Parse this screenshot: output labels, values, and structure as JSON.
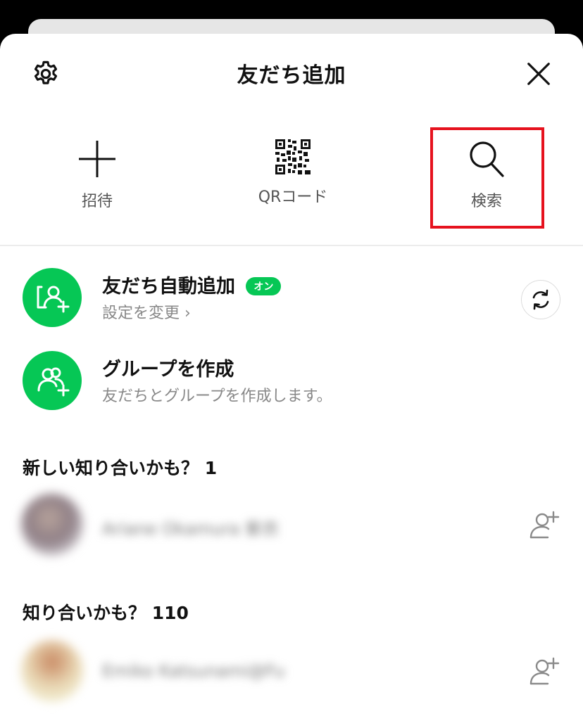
{
  "header": {
    "title": "友だち追加"
  },
  "actions": {
    "invite_label": "招待",
    "qr_label": "QRコード",
    "search_label": "検索"
  },
  "auto_add": {
    "title": "友だち自動追加",
    "badge": "オン",
    "subtitle": "設定を変更 ›"
  },
  "create_group": {
    "title": "グループを作成",
    "subtitle": "友だちとグループを作成します。"
  },
  "sections": {
    "new_suggestions": "新しい知り合いかも？ 1",
    "suggestions": "知り合いかも？ 110"
  },
  "people": [
    {
      "name": "Ariane Okamura 紫衣"
    },
    {
      "name": "Emiko Katsunami@Fu"
    }
  ],
  "colors": {
    "accent": "#06c755",
    "highlight_border": "#e6121e"
  }
}
